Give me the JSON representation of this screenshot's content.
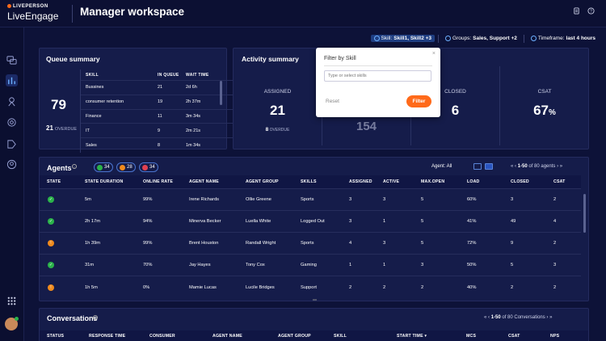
{
  "header": {
    "brand_small": "LIVEPERSON",
    "brand_big": "LiveEngage",
    "title": "Manager workspace"
  },
  "filters": {
    "skill_prefix": "Skill:",
    "skill_value": "Skill1, Skill2 +3",
    "groups_prefix": "Groups:",
    "groups_value": "Sales, Support +2",
    "timeframe_prefix": "Timeframe:",
    "timeframe_value": "last 4 hours"
  },
  "queue": {
    "title": "Queue summary",
    "total": "79",
    "overdue_count": "21",
    "overdue_label": "OVERDUE",
    "headers": [
      "SKILL",
      "IN QUEUE",
      "WAIT TIME"
    ],
    "rows": [
      [
        "Bussines",
        "21",
        "2d 6h"
      ],
      [
        "consumer retention",
        "19",
        "2h 37m"
      ],
      [
        "Finance",
        "11",
        "3m 34s"
      ],
      [
        "IT",
        "9",
        "2m 21s"
      ],
      [
        "Sales",
        "8",
        "1m 34s"
      ]
    ]
  },
  "activity": {
    "title": "Activity summary",
    "assigned_label": "ASSIGNED",
    "assigned_value": "21",
    "assigned_overdue_count": "8",
    "assigned_overdue_label": "OVERDUE",
    "hidden_value": "154",
    "closed_label": "CLOSED",
    "closed_value": "6",
    "csat_label": "CSAT",
    "csat_value": "67",
    "csat_unit": "%"
  },
  "popup": {
    "title": "Filter by Skill",
    "placeholder": "Type or select skills",
    "reset": "Reset",
    "filter": "Filter",
    "close": "×"
  },
  "agents": {
    "title": "Agents",
    "pill_online": "34",
    "pill_away": "28",
    "pill_busy": "34",
    "agent_filter": "Agent: All",
    "pager": "1-50",
    "pager_of": "of 80 agents",
    "headers": [
      "STATE",
      "STATE DURATION",
      "ONLINE RATE",
      "AGENT NAME",
      "AGENT GROUP",
      "SKILLS",
      "ASSIGNED",
      "ACTIVE",
      "MAX.OPEN",
      "LOAD",
      "CLOSED",
      "CSAT"
    ],
    "rows": [
      {
        "state": "online",
        "duration": "5m",
        "rate": "99%",
        "name": "Irene Richards",
        "group": "Ollie Greene",
        "skill": "Sports",
        "assigned": "3",
        "active": "3",
        "max": "5",
        "load": "60%",
        "closed": "3",
        "csat": "2"
      },
      {
        "state": "online",
        "duration": "2h 17m",
        "rate": "94%",
        "name": "Minerva Becker",
        "group": "Luella White",
        "skill": "Logged Out",
        "assigned": "3",
        "active": "1",
        "max": "5",
        "load": "41%",
        "closed": "49",
        "csat": "4"
      },
      {
        "state": "away",
        "duration": "1h 39m",
        "rate": "99%",
        "name": "Brent Houston",
        "group": "Randall Wright",
        "skill": "Sports",
        "assigned": "4",
        "active": "3",
        "max": "5",
        "load": "72%",
        "closed": "9",
        "csat": "2"
      },
      {
        "state": "online",
        "duration": "31m",
        "rate": "70%",
        "name": "Jay Hayes",
        "group": "Tony Cox",
        "skill": "Gaming",
        "assigned": "1",
        "active": "1",
        "max": "3",
        "load": "50%",
        "closed": "5",
        "csat": "3"
      },
      {
        "state": "away",
        "duration": "1h 5m",
        "rate": "0%",
        "name": "Mamie Lucas",
        "group": "Lucile Bridges",
        "skill": "Support",
        "assigned": "2",
        "active": "2",
        "max": "2",
        "load": "40%",
        "closed": "2",
        "csat": "2"
      }
    ]
  },
  "conversations": {
    "title": "Conversations",
    "pager": "1-50",
    "pager_of": "of 80 Conversations",
    "headers": [
      "STATUS",
      "RESPONSE TIME",
      "CONSUMER",
      "AGENT NAME",
      "AGENT GROUP",
      "SKILL",
      "START TIME ▾",
      "MCS",
      "CSAT",
      "NPS"
    ]
  },
  "colors": {
    "accent": "#ff6a1a",
    "bg": "#0d1238",
    "card": "#151c4a",
    "online": "#2bb34a",
    "away": "#f08a1c",
    "busy": "#e04050"
  }
}
